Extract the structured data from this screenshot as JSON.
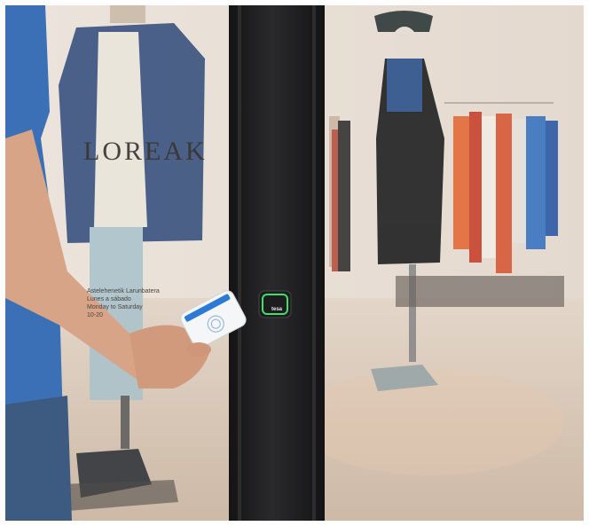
{
  "store_sign": {
    "text": "LOREAK"
  },
  "glass_note": {
    "lines": [
      "Astelehenetik Larunbatera",
      "Lunes a sábado",
      "Monday to Saturday",
      "10-20"
    ]
  },
  "lock_brand": {
    "text": "tesa"
  },
  "phone_screen": {
    "icon": "nfc-wave-icon"
  },
  "colors": {
    "wall": "#e9e1d9",
    "floor": "#d8c8b8",
    "door_frame": "#1c1c1d",
    "lock_led": "#3ee06a",
    "shirt": "#3b6fb6",
    "jeans": "#3d5a80",
    "skin": "#d8a487"
  }
}
